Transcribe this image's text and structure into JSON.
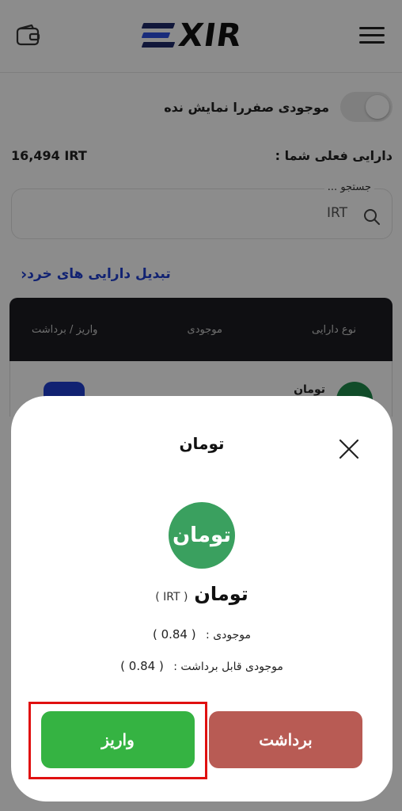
{
  "header": {
    "logo_text": "XIR",
    "wallet_icon": "wallet-icon",
    "menu_icon": "hamburger-icon",
    "logo_colors": [
      "#1f2a6b",
      "#2d4fe0",
      "#111111"
    ]
  },
  "filters": {
    "hide_zero_label": "موجودی صفررا نمایش نده"
  },
  "balance": {
    "label": "دارایی فعلی شما :",
    "value": "16,494 IRT"
  },
  "search": {
    "label": "جستجو ...",
    "value": "IRT",
    "icon": "search-icon"
  },
  "swap_link": {
    "label": "تبدیل دارایی های خرد",
    "icon": "chevron-left-icon"
  },
  "table": {
    "headers": [
      "نوع دارایی",
      "موجودی",
      "واریز / برداشت"
    ],
    "rows": [
      {
        "name": "تومان"
      }
    ]
  },
  "modal": {
    "title": "تومان",
    "close_icon": "close-icon",
    "coin_logo_text": "تومان",
    "coin_name": "تومان",
    "coin_symbol": "( IRT )",
    "balance_label": "موجودی :",
    "balance_value": "( 0.84 )",
    "withdrawable_label": "موجودی قابل برداشت :",
    "withdrawable_value": "( 0.84 )",
    "deposit_label": "واریز",
    "withdraw_label": "برداشت",
    "colors": {
      "deposit": "#35b342",
      "withdraw": "#b85b54",
      "coin": "#3aa05f",
      "highlight": "#e01010"
    }
  }
}
